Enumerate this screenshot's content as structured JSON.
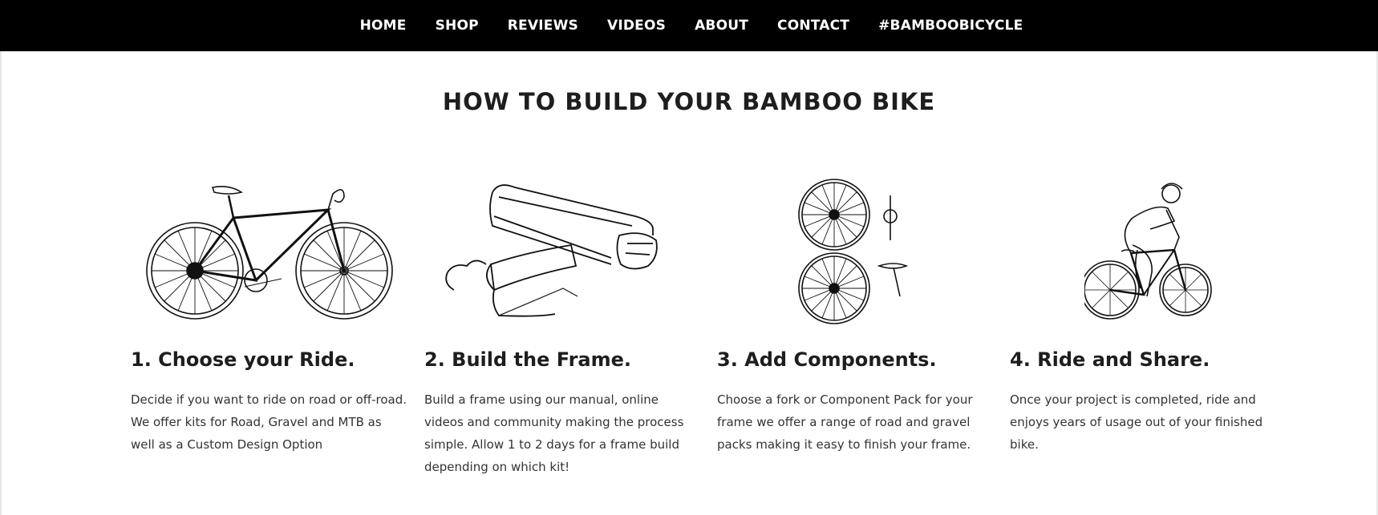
{
  "nav": {
    "items": [
      {
        "label": "HOME"
      },
      {
        "label": "SHOP"
      },
      {
        "label": "REVIEWS"
      },
      {
        "label": "VIDEOS"
      },
      {
        "label": "ABOUT"
      },
      {
        "label": "CONTACT"
      },
      {
        "label": "#BAMBOOBICYCLE"
      }
    ]
  },
  "section": {
    "title": "HOW TO BUILD YOUR BAMBOO BIKE"
  },
  "steps": [
    {
      "icon": "road-bike-icon",
      "title": "1. Choose your Ride.",
      "body": "Decide if you want to ride on road or off-road. We offer kits for Road, Gravel and MTB as well as a Custom Design Option"
    },
    {
      "icon": "hacksaw-icon",
      "title": "2. Build the Frame.",
      "body": "Build a frame using our manual, online videos and community making the process simple. Allow 1 to 2 days for a frame build depending on which kit!"
    },
    {
      "icon": "components-icon",
      "title": "3. Add Components.",
      "body": "Choose a fork or Component Pack for your frame we offer a range of road and gravel packs making it easy to finish your frame."
    },
    {
      "icon": "cyclist-icon",
      "title": "4. Ride and Share.",
      "body": "Once your project is completed, ride and enjoys years of usage out of your finished bike."
    }
  ]
}
